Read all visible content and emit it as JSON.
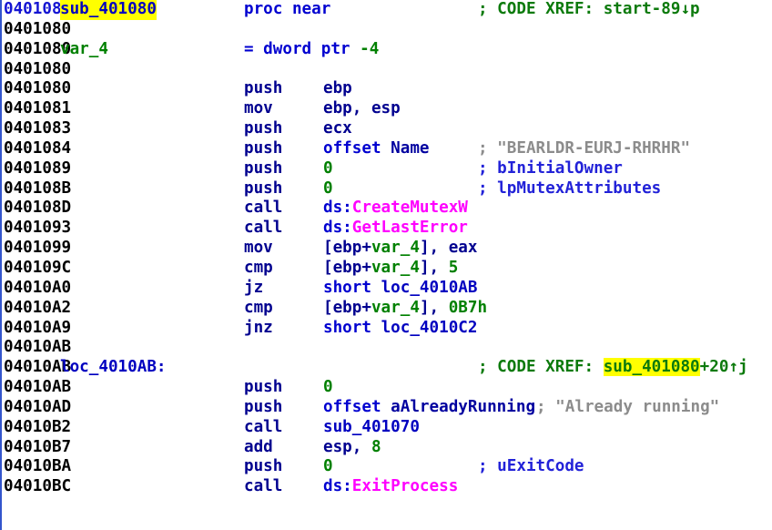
{
  "app": {
    "view": "IDA View-A",
    "kind": "disassembly-listing"
  },
  "colors": {
    "background": "#ffffff",
    "address": "#000000",
    "current_address": "#1414d2",
    "mnemonic": "#00008f",
    "register": "#00008f",
    "number": "#008000",
    "local_variable": "#008000",
    "library_function": "#ff00ff",
    "location_name": "#0000c0",
    "xref_comment": "#0c7a0c",
    "string_comment": "#8c8c8c",
    "auto_comment": "#2222d8",
    "highlight": "#ffff00",
    "arrow_gutter": "#3355cc"
  },
  "function": {
    "name": "sub_401080",
    "declaration": "proc near",
    "start_address": "0401080",
    "locals": [
      {
        "name": "var_4",
        "definition": "= dword ptr -4"
      }
    ]
  },
  "lines": [
    {
      "address": "0401080",
      "address_current": true,
      "label": "sub_401080",
      "label_highlight": true,
      "label_kind": "function-name",
      "mnemonic": "",
      "operands": [
        {
          "text": "proc near",
          "kind": "keyword"
        }
      ],
      "operand_column": "mnem",
      "comment": "; CODE XREF: start-89↓p",
      "comment_kind": "xref"
    },
    {
      "address": "0401080",
      "label": "",
      "mnemonic": "",
      "operands": [],
      "comment": ""
    },
    {
      "address": "0401080",
      "label": "var_4",
      "label_kind": "local-var",
      "mnemonic": "",
      "operands": [
        {
          "text": "= dword ptr ",
          "kind": "keyword"
        },
        {
          "text": "-4",
          "kind": "number"
        }
      ],
      "operand_column": "mnem",
      "comment": ""
    },
    {
      "address": "0401080",
      "label": "",
      "mnemonic": "",
      "operands": [],
      "comment": ""
    },
    {
      "address": "0401080",
      "label": "",
      "mnemonic": "push",
      "operands": [
        {
          "text": "ebp",
          "kind": "register"
        }
      ],
      "comment": ""
    },
    {
      "address": "0401081",
      "label": "",
      "mnemonic": "mov",
      "operands": [
        {
          "text": "ebp, esp",
          "kind": "register"
        }
      ],
      "comment": ""
    },
    {
      "address": "0401083",
      "label": "",
      "mnemonic": "push",
      "operands": [
        {
          "text": "ecx",
          "kind": "register"
        }
      ],
      "comment": ""
    },
    {
      "address": "0401084",
      "label": "",
      "mnemonic": "push",
      "operands": [
        {
          "text": "offset ",
          "kind": "keyword"
        },
        {
          "text": "Name",
          "kind": "dataname"
        }
      ],
      "comment": "; \"BEARLDR-EURJ-RHRHR\"",
      "comment_kind": "string"
    },
    {
      "address": "0401089",
      "label": "",
      "mnemonic": "push",
      "operands": [
        {
          "text": "0",
          "kind": "number"
        }
      ],
      "comment": "; bInitialOwner",
      "comment_kind": "auto"
    },
    {
      "address": "040108B",
      "label": "",
      "mnemonic": "push",
      "operands": [
        {
          "text": "0",
          "kind": "number"
        }
      ],
      "comment": "; lpMutexAttributes",
      "comment_kind": "auto"
    },
    {
      "address": "040108D",
      "label": "",
      "mnemonic": "call",
      "operands": [
        {
          "text": "ds:",
          "kind": "keyword"
        },
        {
          "text": "CreateMutexW",
          "kind": "libfunc"
        }
      ],
      "comment": ""
    },
    {
      "address": "0401093",
      "label": "",
      "mnemonic": "call",
      "operands": [
        {
          "text": "ds:",
          "kind": "keyword"
        },
        {
          "text": "GetLastError",
          "kind": "libfunc"
        }
      ],
      "comment": ""
    },
    {
      "address": "0401099",
      "label": "",
      "mnemonic": "mov",
      "operands": [
        {
          "text": "[ebp+",
          "kind": "register"
        },
        {
          "text": "var_4",
          "kind": "localvar"
        },
        {
          "text": "], eax",
          "kind": "register"
        }
      ],
      "comment": ""
    },
    {
      "address": "040109C",
      "label": "",
      "mnemonic": "cmp",
      "operands": [
        {
          "text": "[ebp+",
          "kind": "register"
        },
        {
          "text": "var_4",
          "kind": "localvar"
        },
        {
          "text": "], ",
          "kind": "register"
        },
        {
          "text": "5",
          "kind": "number"
        }
      ],
      "comment": ""
    },
    {
      "address": "04010A0",
      "label": "",
      "mnemonic": "jz",
      "operands": [
        {
          "text": "short ",
          "kind": "keyword"
        },
        {
          "text": "loc_4010AB",
          "kind": "locname"
        }
      ],
      "comment": ""
    },
    {
      "address": "04010A2",
      "label": "",
      "mnemonic": "cmp",
      "operands": [
        {
          "text": "[ebp+",
          "kind": "register"
        },
        {
          "text": "var_4",
          "kind": "localvar"
        },
        {
          "text": "], ",
          "kind": "register"
        },
        {
          "text": "0B7h",
          "kind": "number"
        }
      ],
      "comment": ""
    },
    {
      "address": "04010A9",
      "label": "",
      "mnemonic": "jnz",
      "operands": [
        {
          "text": "short ",
          "kind": "keyword"
        },
        {
          "text": "loc_4010C2",
          "kind": "locname"
        }
      ],
      "comment": ""
    },
    {
      "address": "04010AB",
      "label": "",
      "mnemonic": "",
      "operands": [],
      "comment": ""
    },
    {
      "address": "04010AB",
      "label": "loc_4010AB:",
      "label_kind": "location-name",
      "mnemonic": "",
      "operands": [],
      "comment": "; CODE XREF: sub_401080+20↑j",
      "comment_kind": "xref",
      "comment_highlight_token": "sub_401080",
      "comment_prefix": "; CODE XREF: ",
      "comment_suffix": "+20↑j"
    },
    {
      "address": "04010AB",
      "label": "",
      "mnemonic": "push",
      "operands": [
        {
          "text": "0",
          "kind": "number"
        }
      ],
      "comment": ""
    },
    {
      "address": "04010AD",
      "label": "",
      "mnemonic": "push",
      "operands": [
        {
          "text": "offset ",
          "kind": "keyword"
        },
        {
          "text": "aAlreadyRunning",
          "kind": "dataname"
        }
      ],
      "comment": "; \"Already running\"",
      "comment_kind": "string",
      "comment_inline": true
    },
    {
      "address": "04010B2",
      "label": "",
      "mnemonic": "call",
      "operands": [
        {
          "text": "sub_401070",
          "kind": "locname"
        }
      ],
      "comment": ""
    },
    {
      "address": "04010B7",
      "label": "",
      "mnemonic": "add",
      "operands": [
        {
          "text": "esp, ",
          "kind": "register"
        },
        {
          "text": "8",
          "kind": "number"
        }
      ],
      "comment": ""
    },
    {
      "address": "04010BA",
      "label": "",
      "mnemonic": "push",
      "operands": [
        {
          "text": "0",
          "kind": "number"
        }
      ],
      "comment": "; uExitCode",
      "comment_kind": "auto"
    },
    {
      "address": "04010BC",
      "label": "",
      "mnemonic": "call",
      "operands": [
        {
          "text": "ds:",
          "kind": "keyword"
        },
        {
          "text": "ExitProcess",
          "kind": "libfunc"
        }
      ],
      "comment": ""
    }
  ]
}
